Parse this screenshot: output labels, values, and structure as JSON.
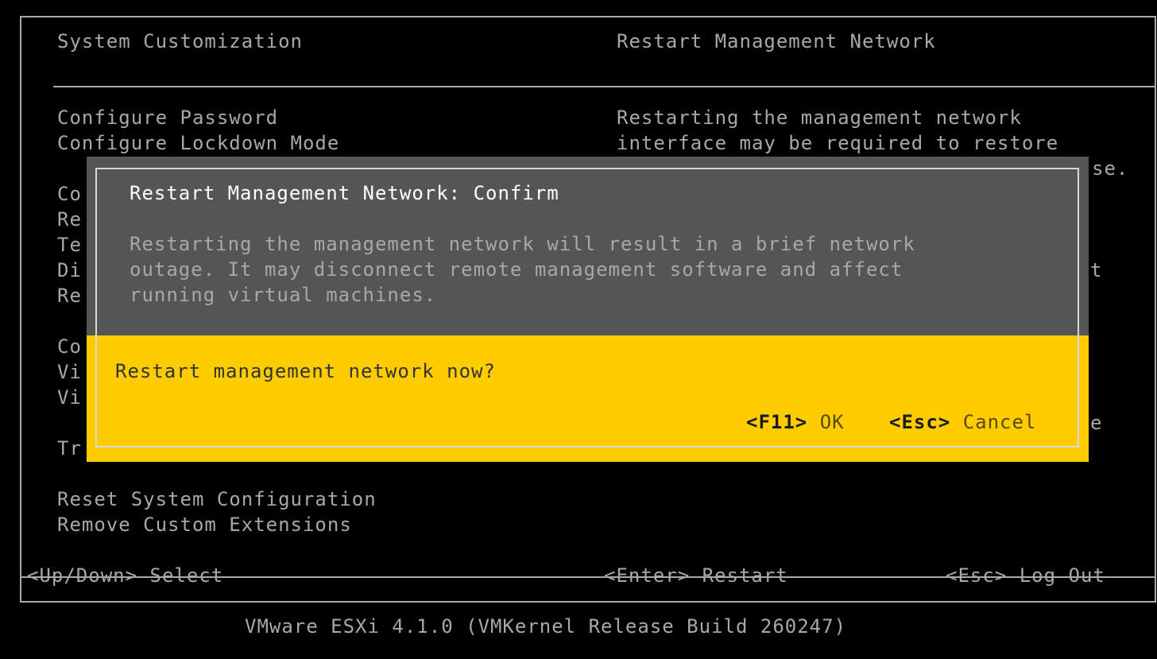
{
  "header": {
    "left_title": "System Customization",
    "right_title": "Restart Management Network"
  },
  "menu": {
    "items": [
      "Configure Password",
      "Configure Lockdown Mode",
      "Co",
      "Re",
      "Te",
      "Di",
      "Re",
      "Co",
      "Vi",
      "Vi",
      "Tr",
      "Reset System Configuration",
      "Remove Custom Extensions"
    ]
  },
  "description": {
    "line1": "Restarting the management network",
    "line2": "interface may be required to restore",
    "frag1": "se.",
    "frag2": "t",
    "frag3": "e"
  },
  "dialog": {
    "title": "Restart Management Network: Confirm",
    "body": [
      "Restarting the management network will result in a brief network",
      "outage. It may disconnect remote management software and affect",
      "running virtual machines."
    ],
    "question": "Restart management network now?",
    "ok_key": "<F11>",
    "ok_label": "OK",
    "cancel_key": "<Esc>",
    "cancel_label": "Cancel"
  },
  "footer": {
    "left_key": "<Up/Down>",
    "left_label": "Select",
    "mid_key": "<Enter>",
    "mid_label": "Restart",
    "right_key": "<Esc>",
    "right_label": "Log Out"
  },
  "version": "VMware ESXi 4.1.0 (VMKernel Release Build 260247)",
  "colors": {
    "background": "#000000",
    "text": "#a8a8a8",
    "dialog_top": "#555555",
    "dialog_bottom": "#ffcc00"
  }
}
